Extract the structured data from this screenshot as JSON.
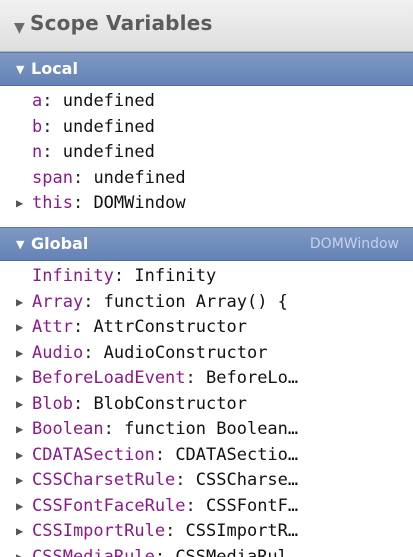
{
  "pane": {
    "title": "Scope Variables"
  },
  "local": {
    "label": "Local",
    "items": [
      {
        "name": "a",
        "value": "undefined",
        "expandable": false
      },
      {
        "name": "b",
        "value": "undefined",
        "expandable": false
      },
      {
        "name": "n",
        "value": "undefined",
        "expandable": false
      },
      {
        "name": "span",
        "value": "undefined",
        "expandable": false
      },
      {
        "name": "this",
        "value": "DOMWindow",
        "expandable": true
      }
    ]
  },
  "global": {
    "label": "Global",
    "subtitle": "DOMWindow",
    "items": [
      {
        "name": "Infinity",
        "value": "Infinity",
        "expandable": false
      },
      {
        "name": "Array",
        "value": "function Array() {",
        "expandable": true
      },
      {
        "name": "Attr",
        "value": "AttrConstructor",
        "expandable": true
      },
      {
        "name": "Audio",
        "value": "AudioConstructor",
        "expandable": true
      },
      {
        "name": "BeforeLoadEvent",
        "value": "BeforeLo…",
        "expandable": true
      },
      {
        "name": "Blob",
        "value": "BlobConstructor",
        "expandable": true
      },
      {
        "name": "Boolean",
        "value": "function Boolean…",
        "expandable": true
      },
      {
        "name": "CDATASection",
        "value": "CDATASectio…",
        "expandable": true
      },
      {
        "name": "CSSCharsetRule",
        "value": "CSSCharse…",
        "expandable": true
      },
      {
        "name": "CSSFontFaceRule",
        "value": "CSSFontF…",
        "expandable": true
      },
      {
        "name": "CSSImportRule",
        "value": "CSSImportR…",
        "expandable": true
      },
      {
        "name": "CSSMediaRule",
        "value": "CSSMediaRul",
        "expandable": true
      }
    ]
  },
  "icons": {
    "collapse": "disclosure-down-icon",
    "expand": "disclosure-right-icon"
  }
}
